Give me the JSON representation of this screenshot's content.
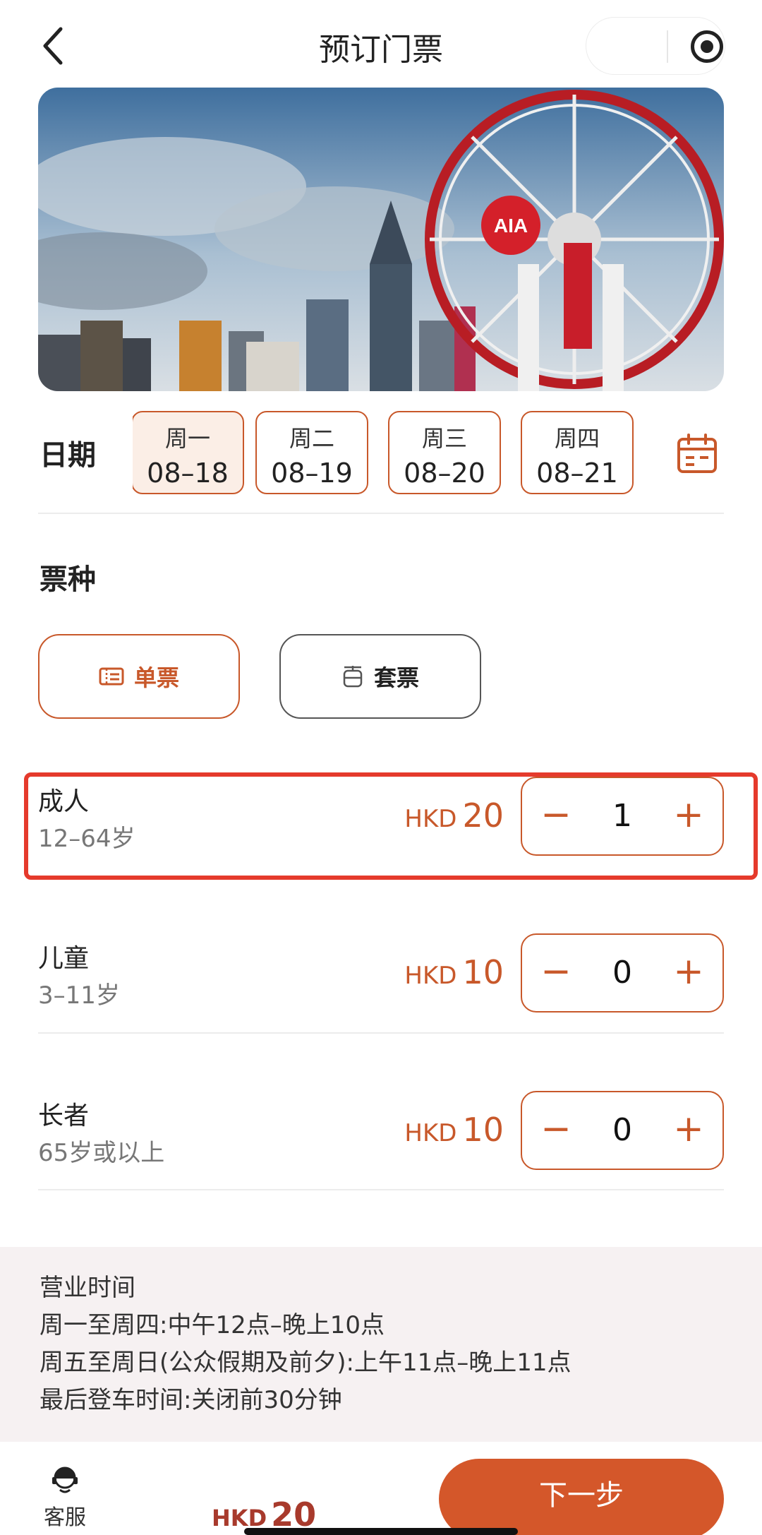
{
  "header": {
    "title": "预订门票"
  },
  "banner": {
    "logo_text": "AIA"
  },
  "dates": {
    "label": "日期",
    "items": [
      {
        "weekday": "周一",
        "date": "08–18",
        "selected": true
      },
      {
        "weekday": "周二",
        "date": "08–19",
        "selected": false
      },
      {
        "weekday": "周三",
        "date": "08–20",
        "selected": false
      },
      {
        "weekday": "周四",
        "date": "08–21",
        "selected": false
      }
    ]
  },
  "ticket_type": {
    "title": "票种",
    "options": [
      {
        "label": "单票",
        "selected": true
      },
      {
        "label": "套票",
        "selected": false
      }
    ]
  },
  "tickets": [
    {
      "name": "成人",
      "age": "12–64岁",
      "currency": "HKD",
      "price": "20",
      "quantity": "1"
    },
    {
      "name": "儿童",
      "age": "3–11岁",
      "currency": "HKD",
      "price": "10",
      "quantity": "0"
    },
    {
      "name": "长者",
      "age": "65岁或以上",
      "currency": "HKD",
      "price": "10",
      "quantity": "0"
    }
  ],
  "stepper": {
    "minus": "−",
    "plus": "+"
  },
  "info": {
    "lines": [
      "营业时间",
      "周一至周四:中午12点–晚上10点",
      "周五至周日(公众假期及前夕):上午11点–晚上11点",
      "最后登车时间:关闭前30分钟"
    ]
  },
  "footer": {
    "service_label": "客服",
    "total_currency": "HKD",
    "total_amount": "20",
    "next_label": "下一步"
  },
  "colors": {
    "accent": "#c8582a",
    "button": "#d4572a",
    "highlight": "#e53a2c",
    "info_bg": "#f6f1f2"
  },
  "icons": [
    "back-icon",
    "more-icon",
    "target-icon",
    "calendar-icon",
    "ticket-icon",
    "cable-car-icon",
    "customer-service-icon"
  ]
}
